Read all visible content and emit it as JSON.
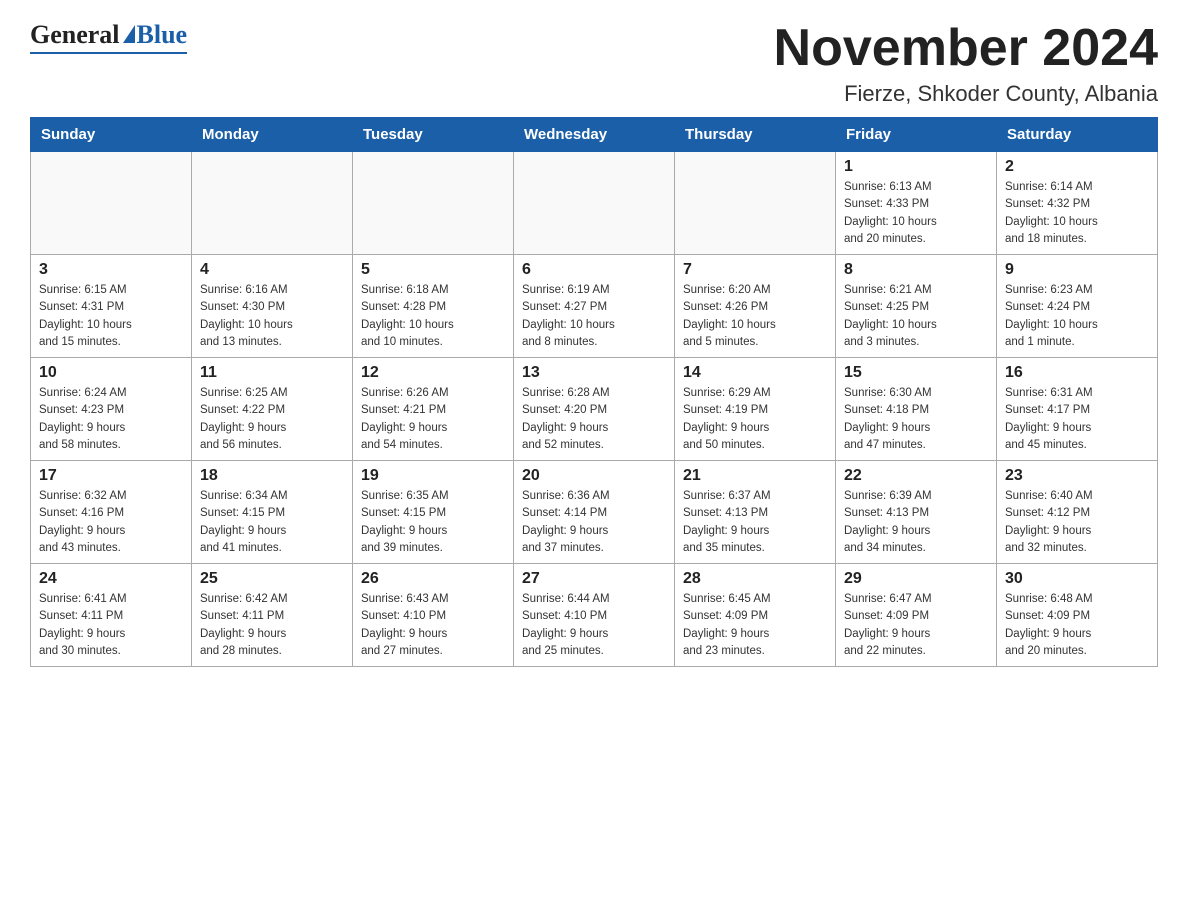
{
  "logo": {
    "general": "General",
    "blue": "Blue"
  },
  "header": {
    "month": "November 2024",
    "location": "Fierze, Shkoder County, Albania"
  },
  "weekdays": [
    "Sunday",
    "Monday",
    "Tuesday",
    "Wednesday",
    "Thursday",
    "Friday",
    "Saturday"
  ],
  "weeks": [
    [
      {
        "day": "",
        "info": ""
      },
      {
        "day": "",
        "info": ""
      },
      {
        "day": "",
        "info": ""
      },
      {
        "day": "",
        "info": ""
      },
      {
        "day": "",
        "info": ""
      },
      {
        "day": "1",
        "info": "Sunrise: 6:13 AM\nSunset: 4:33 PM\nDaylight: 10 hours\nand 20 minutes."
      },
      {
        "day": "2",
        "info": "Sunrise: 6:14 AM\nSunset: 4:32 PM\nDaylight: 10 hours\nand 18 minutes."
      }
    ],
    [
      {
        "day": "3",
        "info": "Sunrise: 6:15 AM\nSunset: 4:31 PM\nDaylight: 10 hours\nand 15 minutes."
      },
      {
        "day": "4",
        "info": "Sunrise: 6:16 AM\nSunset: 4:30 PM\nDaylight: 10 hours\nand 13 minutes."
      },
      {
        "day": "5",
        "info": "Sunrise: 6:18 AM\nSunset: 4:28 PM\nDaylight: 10 hours\nand 10 minutes."
      },
      {
        "day": "6",
        "info": "Sunrise: 6:19 AM\nSunset: 4:27 PM\nDaylight: 10 hours\nand 8 minutes."
      },
      {
        "day": "7",
        "info": "Sunrise: 6:20 AM\nSunset: 4:26 PM\nDaylight: 10 hours\nand 5 minutes."
      },
      {
        "day": "8",
        "info": "Sunrise: 6:21 AM\nSunset: 4:25 PM\nDaylight: 10 hours\nand 3 minutes."
      },
      {
        "day": "9",
        "info": "Sunrise: 6:23 AM\nSunset: 4:24 PM\nDaylight: 10 hours\nand 1 minute."
      }
    ],
    [
      {
        "day": "10",
        "info": "Sunrise: 6:24 AM\nSunset: 4:23 PM\nDaylight: 9 hours\nand 58 minutes."
      },
      {
        "day": "11",
        "info": "Sunrise: 6:25 AM\nSunset: 4:22 PM\nDaylight: 9 hours\nand 56 minutes."
      },
      {
        "day": "12",
        "info": "Sunrise: 6:26 AM\nSunset: 4:21 PM\nDaylight: 9 hours\nand 54 minutes."
      },
      {
        "day": "13",
        "info": "Sunrise: 6:28 AM\nSunset: 4:20 PM\nDaylight: 9 hours\nand 52 minutes."
      },
      {
        "day": "14",
        "info": "Sunrise: 6:29 AM\nSunset: 4:19 PM\nDaylight: 9 hours\nand 50 minutes."
      },
      {
        "day": "15",
        "info": "Sunrise: 6:30 AM\nSunset: 4:18 PM\nDaylight: 9 hours\nand 47 minutes."
      },
      {
        "day": "16",
        "info": "Sunrise: 6:31 AM\nSunset: 4:17 PM\nDaylight: 9 hours\nand 45 minutes."
      }
    ],
    [
      {
        "day": "17",
        "info": "Sunrise: 6:32 AM\nSunset: 4:16 PM\nDaylight: 9 hours\nand 43 minutes."
      },
      {
        "day": "18",
        "info": "Sunrise: 6:34 AM\nSunset: 4:15 PM\nDaylight: 9 hours\nand 41 minutes."
      },
      {
        "day": "19",
        "info": "Sunrise: 6:35 AM\nSunset: 4:15 PM\nDaylight: 9 hours\nand 39 minutes."
      },
      {
        "day": "20",
        "info": "Sunrise: 6:36 AM\nSunset: 4:14 PM\nDaylight: 9 hours\nand 37 minutes."
      },
      {
        "day": "21",
        "info": "Sunrise: 6:37 AM\nSunset: 4:13 PM\nDaylight: 9 hours\nand 35 minutes."
      },
      {
        "day": "22",
        "info": "Sunrise: 6:39 AM\nSunset: 4:13 PM\nDaylight: 9 hours\nand 34 minutes."
      },
      {
        "day": "23",
        "info": "Sunrise: 6:40 AM\nSunset: 4:12 PM\nDaylight: 9 hours\nand 32 minutes."
      }
    ],
    [
      {
        "day": "24",
        "info": "Sunrise: 6:41 AM\nSunset: 4:11 PM\nDaylight: 9 hours\nand 30 minutes."
      },
      {
        "day": "25",
        "info": "Sunrise: 6:42 AM\nSunset: 4:11 PM\nDaylight: 9 hours\nand 28 minutes."
      },
      {
        "day": "26",
        "info": "Sunrise: 6:43 AM\nSunset: 4:10 PM\nDaylight: 9 hours\nand 27 minutes."
      },
      {
        "day": "27",
        "info": "Sunrise: 6:44 AM\nSunset: 4:10 PM\nDaylight: 9 hours\nand 25 minutes."
      },
      {
        "day": "28",
        "info": "Sunrise: 6:45 AM\nSunset: 4:09 PM\nDaylight: 9 hours\nand 23 minutes."
      },
      {
        "day": "29",
        "info": "Sunrise: 6:47 AM\nSunset: 4:09 PM\nDaylight: 9 hours\nand 22 minutes."
      },
      {
        "day": "30",
        "info": "Sunrise: 6:48 AM\nSunset: 4:09 PM\nDaylight: 9 hours\nand 20 minutes."
      }
    ]
  ]
}
